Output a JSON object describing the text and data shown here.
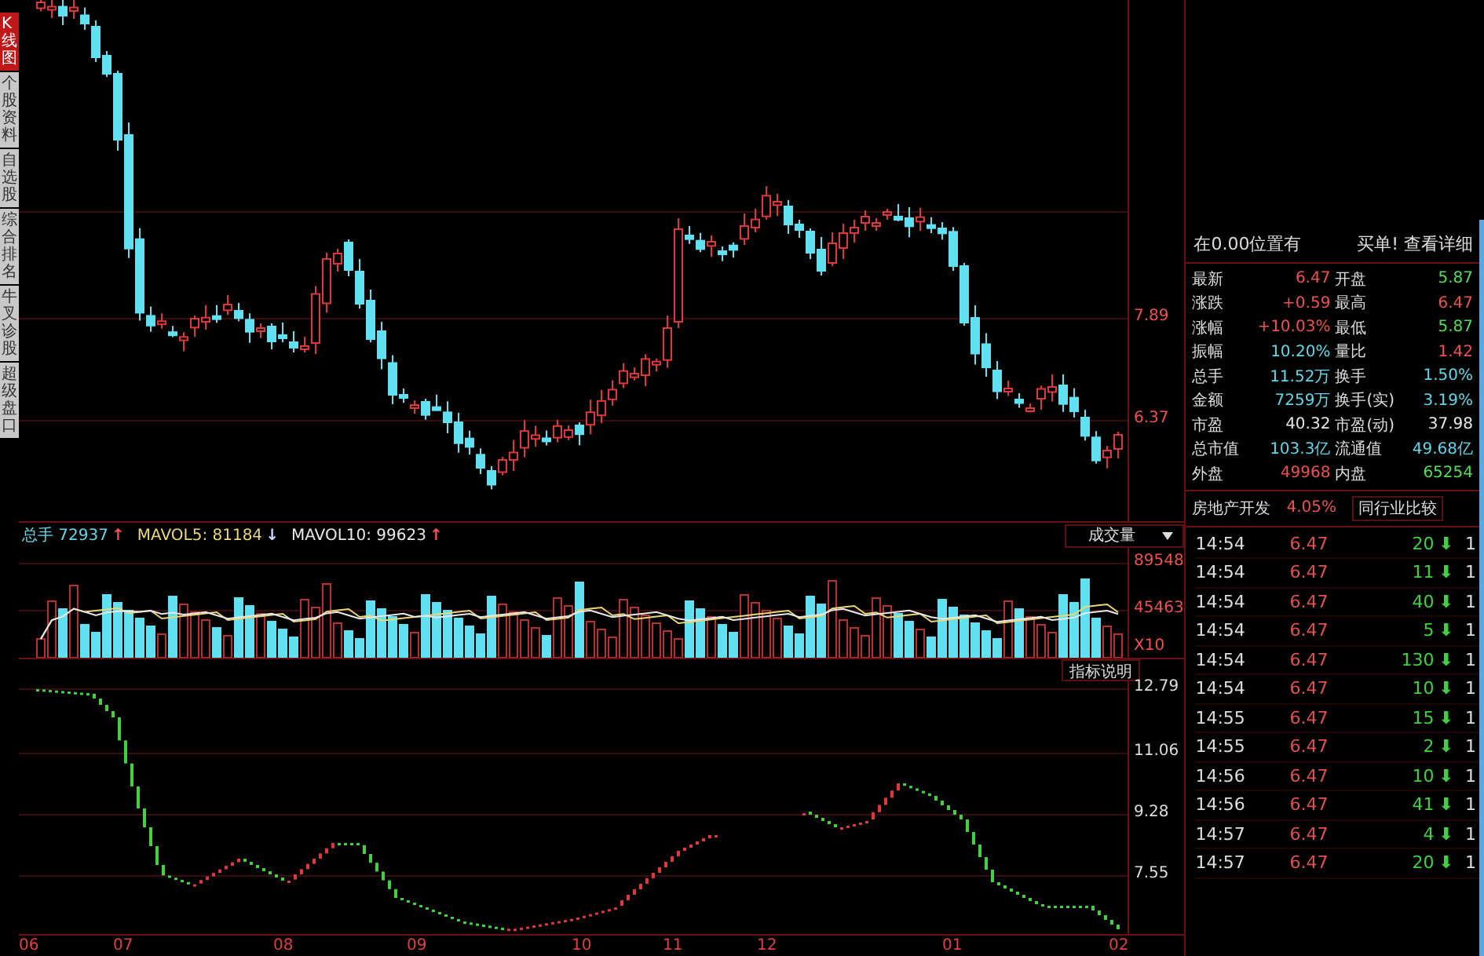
{
  "side_tabs": [
    {
      "label": "K线图",
      "selected": true
    },
    {
      "label": "个股资料",
      "selected": false
    },
    {
      "label": "自选股",
      "selected": false
    },
    {
      "label": "综合排名",
      "selected": false
    },
    {
      "label": "牛叉诊股",
      "selected": false
    },
    {
      "label": "超级盘口",
      "selected": false
    }
  ],
  "price_axis": [
    "7.89",
    "6.37"
  ],
  "volume": {
    "stats": [
      {
        "text": "总手 72937",
        "color": "#60d8e8",
        "arrow": {
          "text": "↑",
          "color": "#f05050"
        }
      },
      {
        "text": "MAVOL5: 81184",
        "color": "#e8d878",
        "arrow": {
          "text": "↓",
          "color": "#c8d8ff"
        }
      },
      {
        "text": "MAVOL10: 99623",
        "color": "#e8e8e8",
        "arrow": {
          "text": "↑",
          "color": "#f05050"
        }
      }
    ],
    "selector": "成交量",
    "axis": [
      "89548",
      "45463",
      "X10"
    ]
  },
  "indicator": {
    "button": "指标说明",
    "axis": [
      "12.79",
      "11.06",
      "9.28",
      "7.55"
    ]
  },
  "months": [
    "06",
    "07",
    "08",
    "09",
    "10",
    "11",
    "12",
    "01",
    "02"
  ],
  "quote": {
    "header_left": "在0.00位置有",
    "header_right": "买单! 查看详细",
    "rows": [
      [
        {
          "label": "最新",
          "value": "6.47",
          "color": "#f05050"
        },
        {
          "label": "开盘",
          "value": "5.87",
          "color": "#50e050"
        }
      ],
      [
        {
          "label": "涨跌",
          "value": "+0.59",
          "color": "#f05050"
        },
        {
          "label": "最高",
          "value": "6.47",
          "color": "#f05050"
        }
      ],
      [
        {
          "label": "涨幅",
          "value": "+10.03%",
          "color": "#f05050"
        },
        {
          "label": "最低",
          "value": "5.87",
          "color": "#50e050"
        }
      ],
      [
        {
          "label": "振幅",
          "value": "10.20%",
          "color": "#60d8e8"
        },
        {
          "label": "量比",
          "value": "1.42",
          "color": "#f05050"
        }
      ],
      [
        {
          "label": "总手",
          "value": "11.52万",
          "color": "#60d8e8"
        },
        {
          "label": "换手",
          "value": "1.50%",
          "color": "#60d8e8"
        }
      ],
      [
        {
          "label": "金额",
          "value": "7259万",
          "color": "#60d8e8"
        },
        {
          "label": "换手(实)",
          "value": "3.19%",
          "color": "#60d8e8"
        }
      ],
      [
        {
          "label": "市盈",
          "value": "40.32",
          "color": "#e8e8e8"
        },
        {
          "label": "市盈(动)",
          "value": "37.98",
          "color": "#e8e8e8"
        }
      ],
      [
        {
          "label": "总市值",
          "value": "103.3亿",
          "color": "#60d8e8"
        },
        {
          "label": "流通值",
          "value": "49.68亿",
          "color": "#60d8e8"
        }
      ],
      [
        {
          "label": "外盘",
          "value": "49968",
          "color": "#f05050"
        },
        {
          "label": "内盘",
          "value": "65254",
          "color": "#50e050"
        }
      ]
    ],
    "industry": {
      "name": "房地产开发",
      "change": "4.05%",
      "compare": "同行业比较"
    }
  },
  "ticks": [
    {
      "time": "14:54",
      "price": "6.47",
      "volume": "20",
      "arrow": "⬇",
      "column_5": "1"
    },
    {
      "time": "14:54",
      "price": "6.47",
      "volume": "11",
      "arrow": "⬇",
      "column_5": "1"
    },
    {
      "time": "14:54",
      "price": "6.47",
      "volume": "40",
      "arrow": "⬇",
      "column_5": "1"
    },
    {
      "time": "14:54",
      "price": "6.47",
      "volume": "5",
      "arrow": "⬇",
      "column_5": "1"
    },
    {
      "time": "14:54",
      "price": "6.47",
      "volume": "130",
      "arrow": "⬇",
      "column_5": "1"
    },
    {
      "time": "14:54",
      "price": "6.47",
      "volume": "10",
      "arrow": "⬇",
      "column_5": "1"
    },
    {
      "time": "14:55",
      "price": "6.47",
      "volume": "15",
      "arrow": "⬇",
      "column_5": "1"
    },
    {
      "time": "14:55",
      "price": "6.47",
      "volume": "2",
      "arrow": "⬇",
      "column_5": "1"
    },
    {
      "time": "14:56",
      "price": "6.47",
      "volume": "10",
      "arrow": "⬇",
      "column_5": "1"
    },
    {
      "time": "14:56",
      "price": "6.47",
      "volume": "41",
      "arrow": "⬇",
      "column_5": "1"
    },
    {
      "time": "14:57",
      "price": "6.47",
      "volume": "4",
      "arrow": "⬇",
      "column_5": "1"
    },
    {
      "time": "14:57",
      "price": "6.47",
      "volume": "20",
      "arrow": "⬇",
      "column_5": "1"
    }
  ]
}
